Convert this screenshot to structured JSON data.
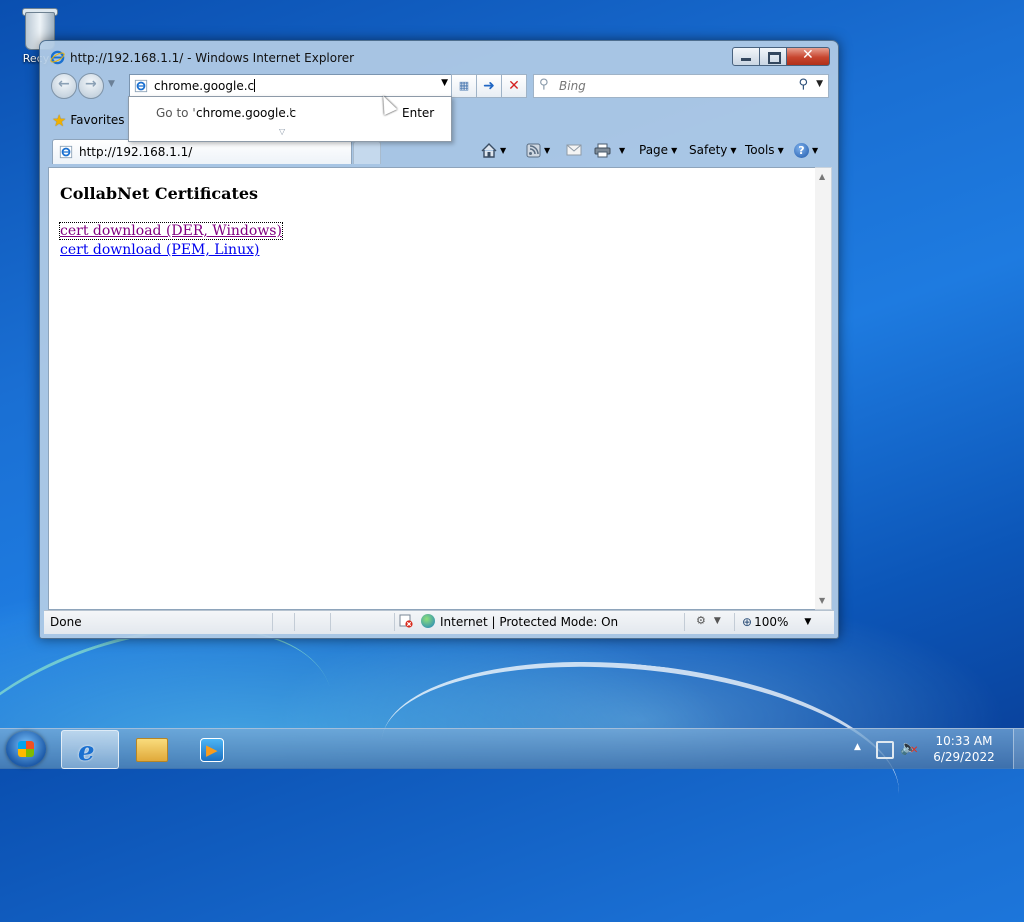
{
  "desktop": {
    "recycle_bin_label": "Recyc"
  },
  "window": {
    "title": "http://192.168.1.1/ - Windows Internet Explorer"
  },
  "address_bar": {
    "value": "chrome.google.c"
  },
  "search": {
    "placeholder": "Bing"
  },
  "autocomplete": {
    "go_to_prefix": "Go to '",
    "url": "chrome.google.c",
    "suffix": "'",
    "enter_label": "Enter"
  },
  "favorites": {
    "label": "Favorites"
  },
  "tab": {
    "title": "http://192.168.1.1/"
  },
  "command_bar": {
    "page": "Page",
    "safety": "Safety",
    "tools": "Tools",
    "help_glyph": "?"
  },
  "content": {
    "heading": "CollabNet Certificates",
    "links": [
      "cert download (DER, Windows)",
      "cert download (PEM, Linux)"
    ]
  },
  "status_bar": {
    "status": "Done",
    "zone": "Internet | Protected Mode: On",
    "zoom": "100%"
  },
  "taskbar": {
    "time": "10:33 AM",
    "date": "6/29/2022"
  },
  "colors": {
    "visited_link": "#800080",
    "link": "#0000ee",
    "close_button": "#c7452e"
  }
}
